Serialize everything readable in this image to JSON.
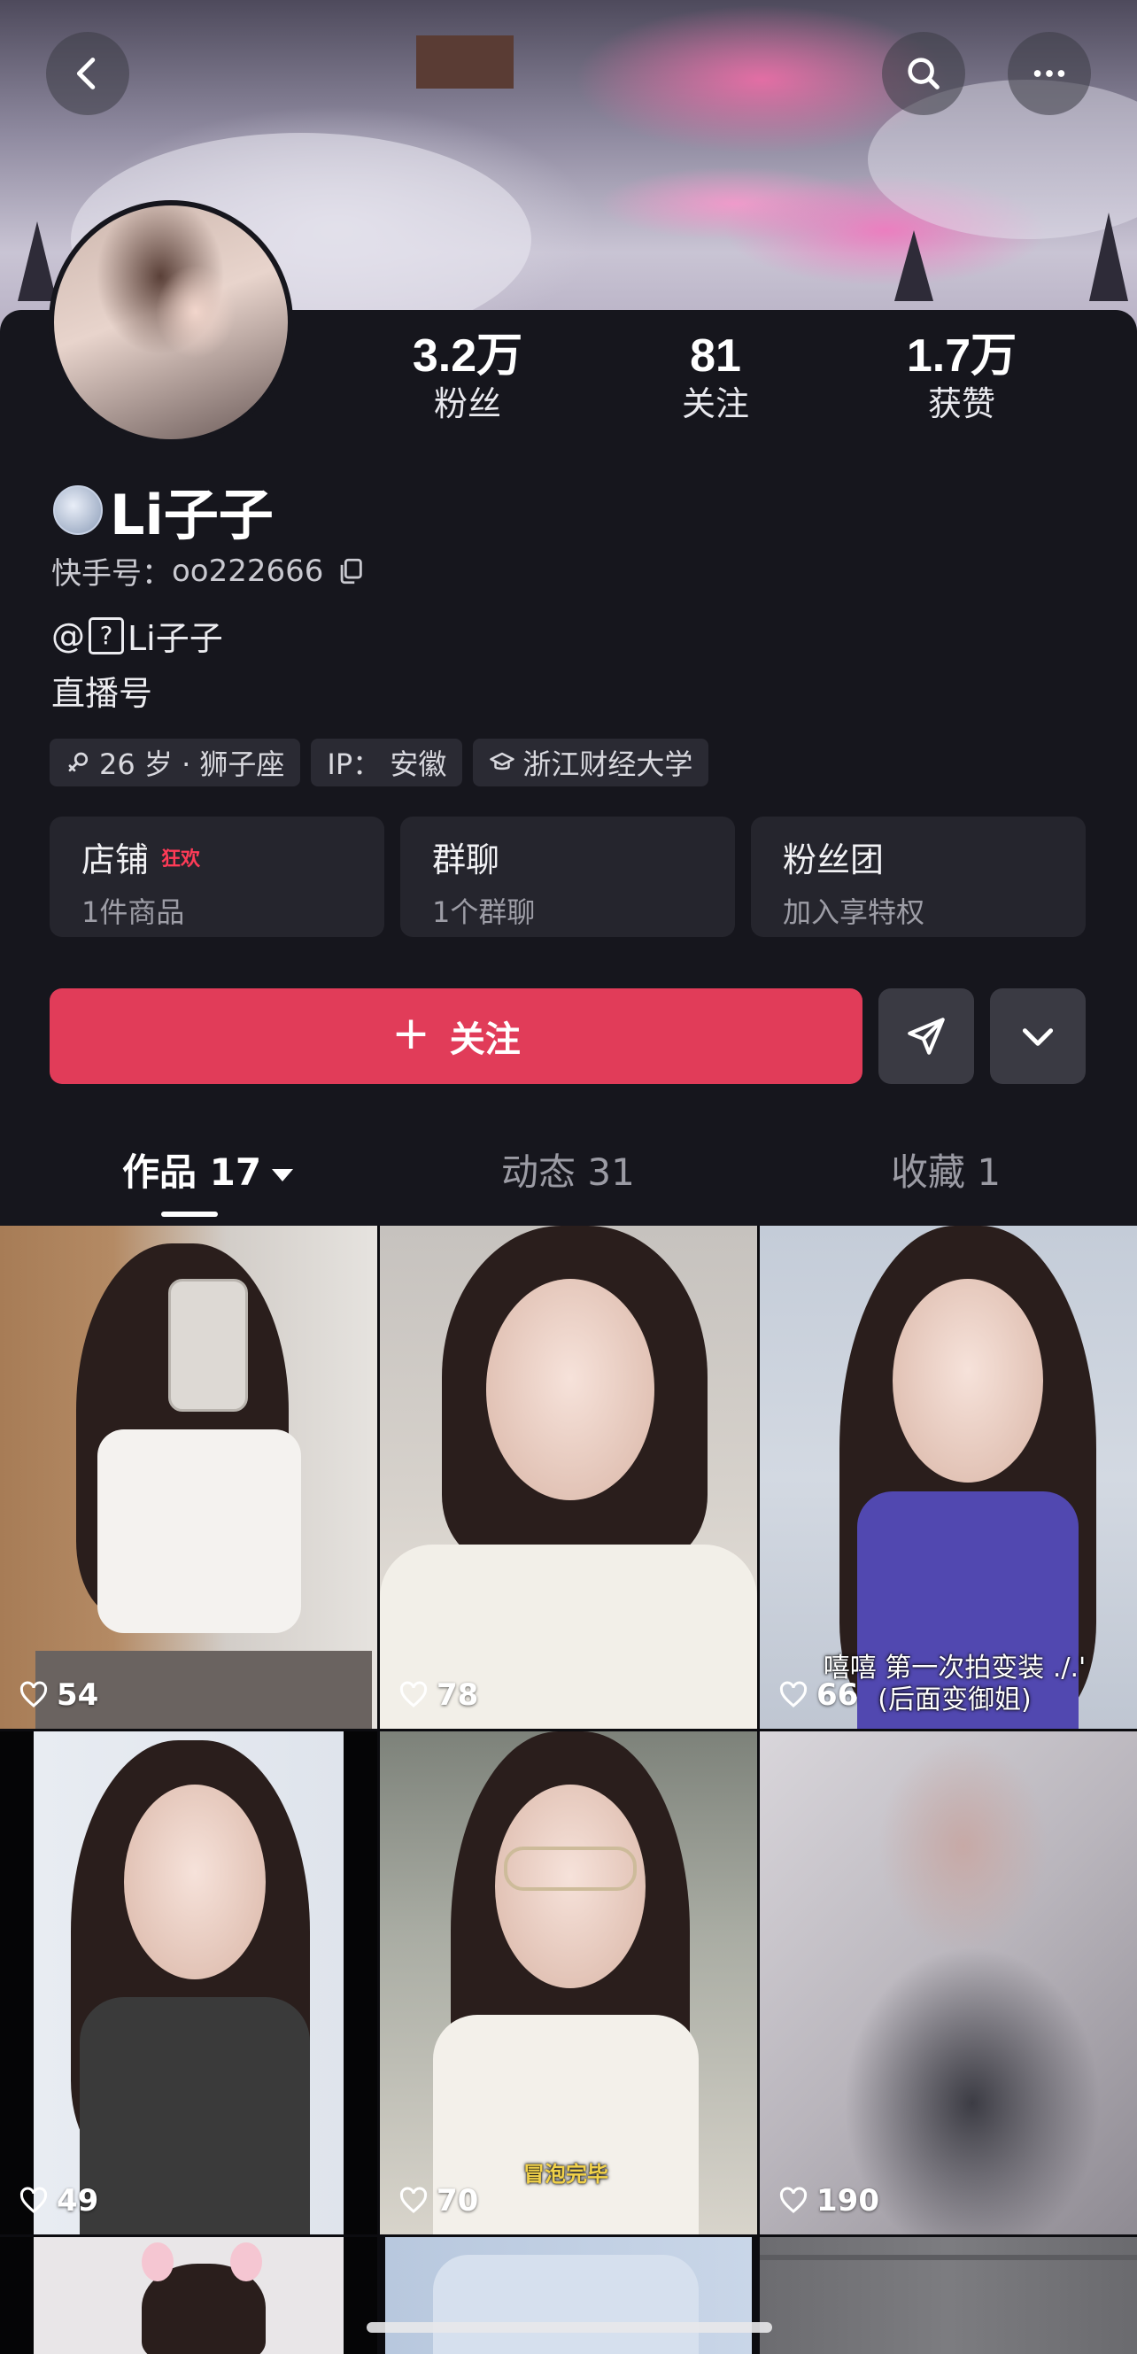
{
  "stats": [
    {
      "value": "3.2万",
      "label": "粉丝"
    },
    {
      "value": "81",
      "label": "关注"
    },
    {
      "value": "1.7万",
      "label": "获赞"
    }
  ],
  "profile": {
    "name": "Li子子",
    "id_label": "快手号：",
    "id_value": "oo222666",
    "bio_prefix": "@",
    "bio_placeholder": "?",
    "bio_mention": "Li子子",
    "bio_line2": "直播号"
  },
  "tags": [
    {
      "icon": "gender-female-icon",
      "text": "26 岁 · 狮子座"
    },
    {
      "icon": "none",
      "text": "IP：  安徽"
    },
    {
      "icon": "graduation-cap-icon",
      "text": "浙江财经大学"
    }
  ],
  "cards": [
    {
      "title": "店铺",
      "hot": "狂欢",
      "sub": "1件商品"
    },
    {
      "title": "群聊",
      "hot": "",
      "sub": "1个群聊"
    },
    {
      "title": "粉丝团",
      "hot": "",
      "sub": "加入享特权"
    }
  ],
  "actions": {
    "follow_label": "关注",
    "follow_icon": "plus-icon",
    "share_icon": "send-icon",
    "more_icon": "chevron-down-icon"
  },
  "header": {
    "back_icon": "back-arrow-icon",
    "search_icon": "search-icon",
    "more_icon": "more-dots-icon"
  },
  "tabs": [
    {
      "label": "作品 17",
      "active": true
    },
    {
      "label": "动态 31",
      "active": false
    },
    {
      "label": "收藏 1",
      "active": false
    }
  ],
  "videos": [
    {
      "likes": "54",
      "caption": ""
    },
    {
      "likes": "78",
      "caption": ""
    },
    {
      "likes": "66",
      "caption": "嘻嘻 第一次拍变装 ./.'\n(后面变御姐)"
    },
    {
      "likes": "49",
      "caption": ""
    },
    {
      "likes": "70",
      "caption": "冒泡完毕"
    },
    {
      "likes": "190",
      "caption": ""
    }
  ],
  "colors": {
    "accent": "#e13c59",
    "background": "#16161d",
    "hot": "#ff3b57"
  }
}
